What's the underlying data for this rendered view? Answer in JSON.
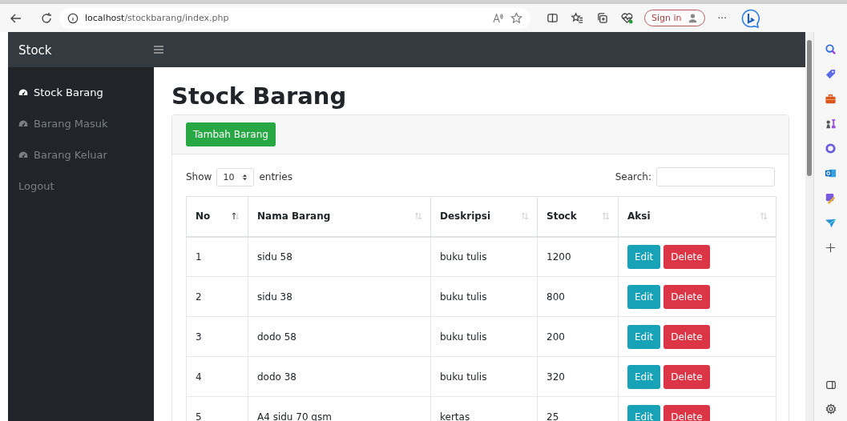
{
  "browser": {
    "address_host": "localhost",
    "address_path": "/stockbarang/index.php",
    "sign_in": "Sign in",
    "more": "···"
  },
  "navbar": {
    "brand": "Stock"
  },
  "sidebar": {
    "items": [
      {
        "label": "Stock Barang",
        "kind": "dashboard",
        "selected": true
      },
      {
        "label": "Barang Masuk",
        "kind": "dashboard",
        "selected": false
      },
      {
        "label": "Barang Keluar",
        "kind": "dashboard",
        "selected": false
      },
      {
        "label": "Logout",
        "kind": "plain",
        "selected": false
      }
    ]
  },
  "page": {
    "title": "Stock Barang",
    "add_button": "Tambah Barang"
  },
  "table_controls": {
    "show_label": "Show",
    "page_size": "10",
    "entries_label": "entries",
    "search_label": "Search:"
  },
  "table": {
    "columns": [
      {
        "label": "No",
        "sorted": true
      },
      {
        "label": "Nama Barang",
        "sorted": false
      },
      {
        "label": "Deskripsi",
        "sorted": false
      },
      {
        "label": "Stock",
        "sorted": false
      },
      {
        "label": "Aksi",
        "sorted": false
      }
    ],
    "rows": [
      {
        "no": "1",
        "name": "sidu 58",
        "description": "buku tulis",
        "stock": "1200",
        "edit": "Edit",
        "delete": "Delete"
      },
      {
        "no": "2",
        "name": "sidu 38",
        "description": "buku tulis",
        "stock": "800",
        "edit": "Edit",
        "delete": "Delete"
      },
      {
        "no": "3",
        "name": "dodo 58",
        "description": "buku tulis",
        "stock": "200",
        "edit": "Edit",
        "delete": "Delete"
      },
      {
        "no": "4",
        "name": "dodo 38",
        "description": "buku tulis",
        "stock": "320",
        "edit": "Edit",
        "delete": "Delete"
      },
      {
        "no": "5",
        "name": "A4 sidu 70 gsm",
        "description": "kertas",
        "stock": "25",
        "edit": "Edit",
        "delete": "Delete"
      }
    ]
  }
}
